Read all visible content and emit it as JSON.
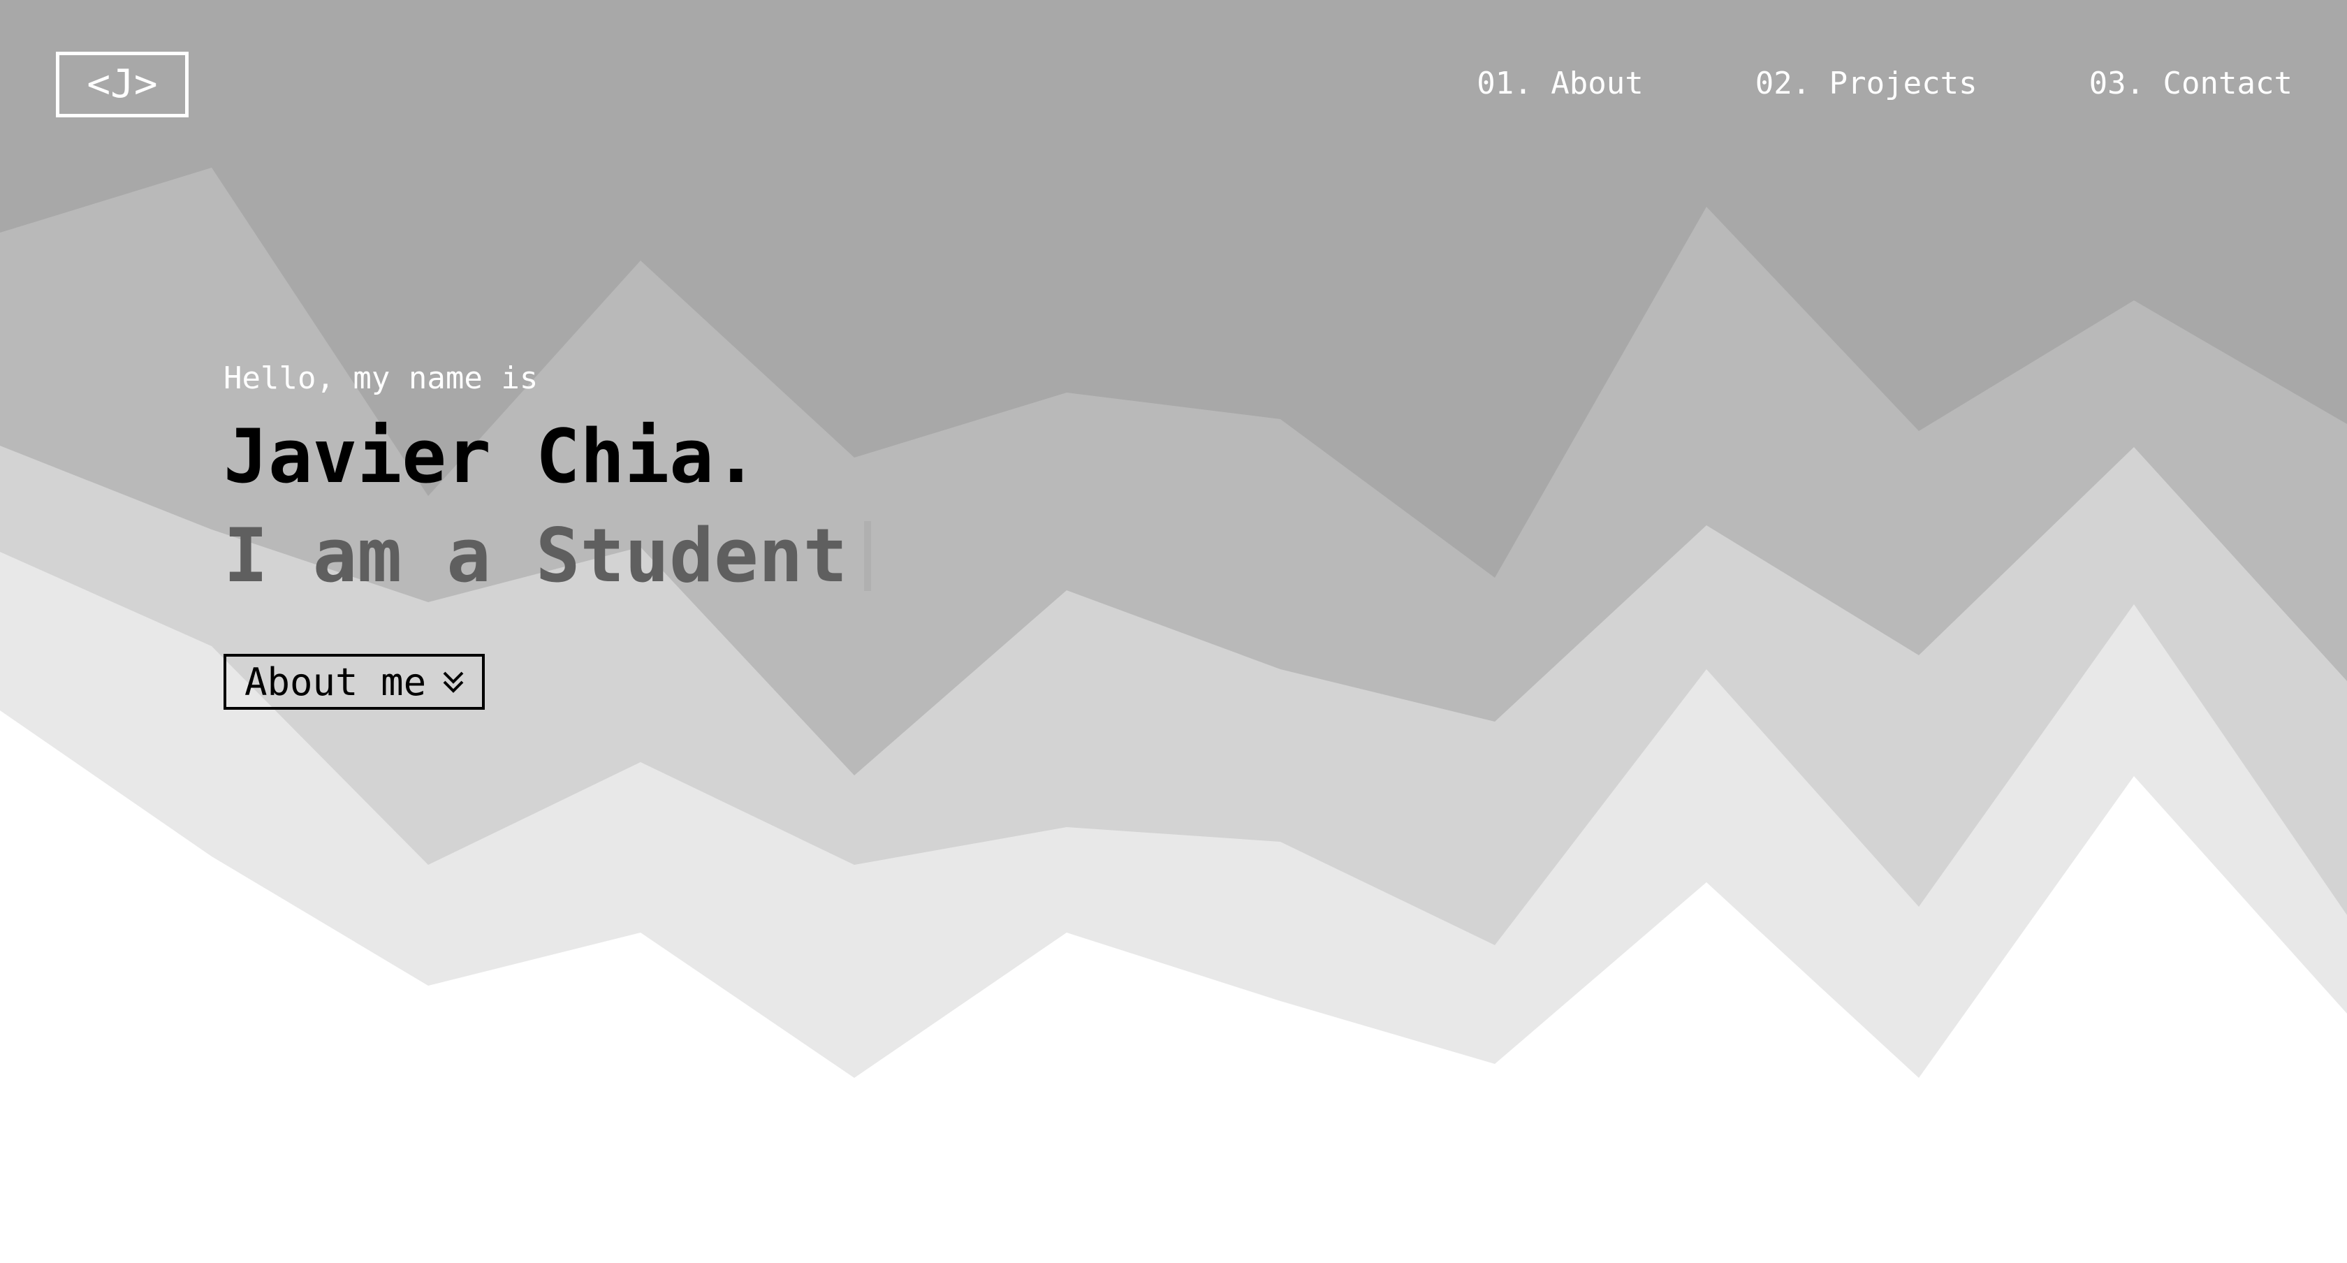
{
  "theme": {
    "sky": "#a8a8a8",
    "layer1": "#b9b9b9",
    "layer2": "#d3d3d3",
    "layer3": "#e8e8e8",
    "ground": "#ffffff",
    "text_light": "#ffffff",
    "text_dark": "#000000",
    "text_muted": "#5f5f5f"
  },
  "header": {
    "logo": "<J>",
    "nav": [
      {
        "label": "01. About"
      },
      {
        "label": "02. Projects"
      },
      {
        "label": "03. Contact"
      }
    ]
  },
  "hero": {
    "greeting": "Hello, my name is",
    "name": "Javier Chia.",
    "role": "I am a Student",
    "button_label": "About me",
    "button_icon": "double-chevron-down-icon"
  }
}
